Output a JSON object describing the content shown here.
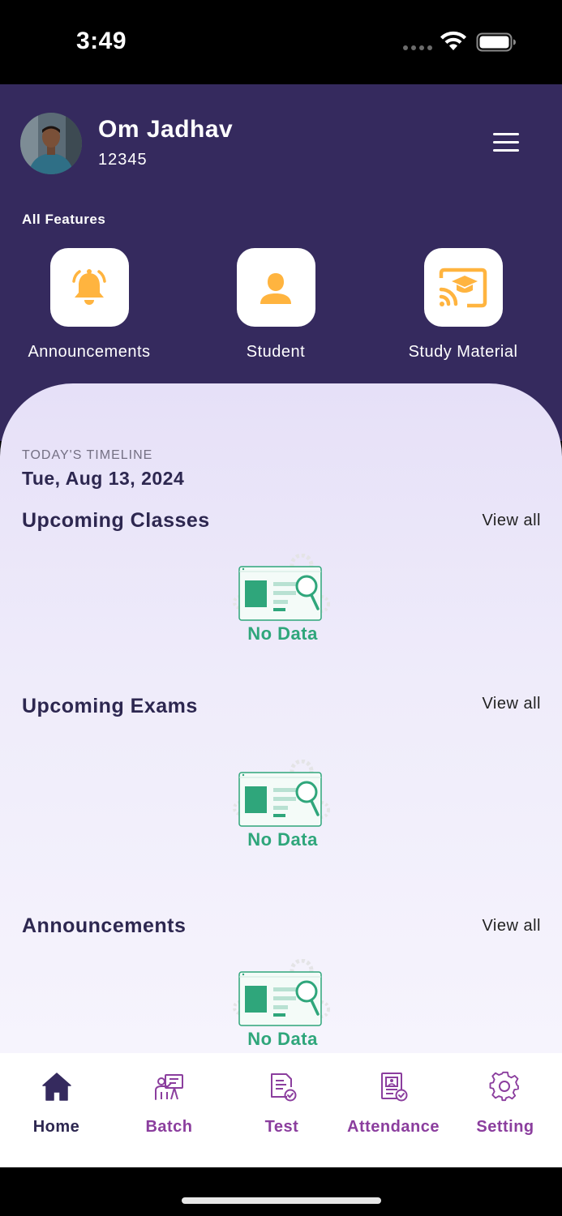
{
  "status_bar": {
    "time": "3:49"
  },
  "profile": {
    "name": "Om Jadhav",
    "id": "12345"
  },
  "features": {
    "section_label": "All Features",
    "items": [
      {
        "label": "Announcements",
        "icon": "bell-icon"
      },
      {
        "label": "Student",
        "icon": "person-icon"
      },
      {
        "label": "Study Material",
        "icon": "cast-education-icon"
      }
    ]
  },
  "timeline": {
    "label": "TODAY'S TIMELINE",
    "date": "Tue, Aug 13, 2024"
  },
  "sections": [
    {
      "title": "Upcoming Classes",
      "view_all": "View all",
      "empty_text": "No Data"
    },
    {
      "title": "Upcoming Exams",
      "view_all": "View all",
      "empty_text": "No Data"
    },
    {
      "title": "Announcements",
      "view_all": "View all",
      "empty_text": "No Data"
    }
  ],
  "bottom_nav": {
    "items": [
      {
        "label": "Home",
        "icon": "home-icon",
        "active": true
      },
      {
        "label": "Batch",
        "icon": "batch-icon"
      },
      {
        "label": "Test",
        "icon": "test-icon"
      },
      {
        "label": "Attendance",
        "icon": "attendance-icon"
      },
      {
        "label": "Setting",
        "icon": "gear-icon"
      }
    ]
  },
  "colors": {
    "header_bg": "#352a5e",
    "accent_orange": "#ffb43f",
    "empty_green": "#2fa67b",
    "nav_active": "#2d2750",
    "nav_inactive": "#8b3e9e"
  }
}
